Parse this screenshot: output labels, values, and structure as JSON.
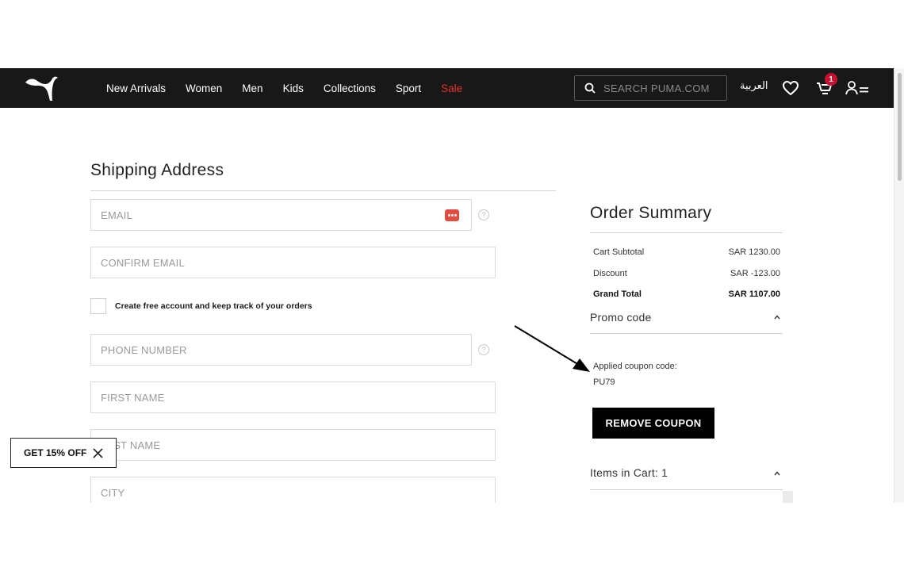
{
  "header": {
    "nav": [
      "New Arrivals",
      "Women",
      "Men",
      "Kids",
      "Collections",
      "Sport",
      "Sale"
    ],
    "search_placeholder": "SEARCH PUMA.COM",
    "language": "العربية",
    "cart_count": "1"
  },
  "shipping": {
    "title": "Shipping Address",
    "email_placeholder": "EMAIL",
    "confirm_email_placeholder": "CONFIRM EMAIL",
    "create_account_label": "Create free account and keep track of your orders",
    "phone_placeholder": "PHONE NUMBER",
    "first_name_placeholder": "FIRST NAME",
    "last_name_placeholder": "LAST NAME",
    "city_placeholder": "CITY",
    "help_glyph": "?"
  },
  "promo_popup": {
    "label": "GET 15% OFF"
  },
  "order_summary": {
    "title": "Order Summary",
    "rows": [
      {
        "label": "Cart Subtotal",
        "value": "SAR 1230.00"
      },
      {
        "label": "Discount",
        "value": "SAR -123.00"
      },
      {
        "label": "Grand Total",
        "value": "SAR 1107.00"
      }
    ],
    "promo_code_label": "Promo code",
    "applied_label": "Applied coupon code:",
    "coupon_code": "PU79",
    "remove_button": "REMOVE COUPON",
    "items_label": "Items in Cart: 1"
  },
  "colors": {
    "header_bg": "#181818",
    "sale": "#e4322b",
    "badge": "#c8102e",
    "button_bg": "#000000"
  }
}
